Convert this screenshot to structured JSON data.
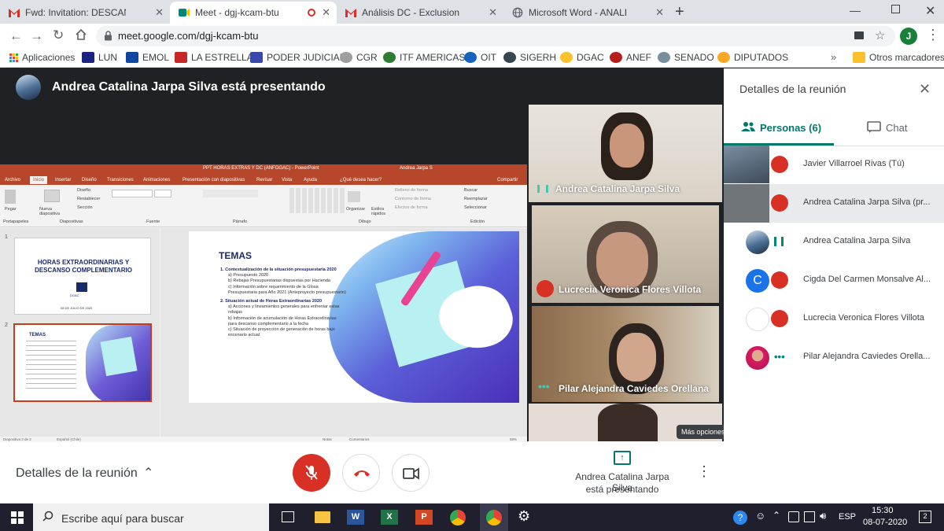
{
  "tabs": [
    {
      "title": "Fwd: Invitation: DESCANSO COM",
      "icon": "gmail-icon"
    },
    {
      "title": "Meet - dgj-kcam-btu",
      "icon": "meet-icon",
      "active": true
    },
    {
      "title": "Análisis DC - Exclusiones Enferme",
      "icon": "gmail-icon"
    },
    {
      "title": "Microsoft Word - ANALISIS POR",
      "icon": "globe-icon"
    }
  ],
  "address": {
    "url": "meet.google.com/dgj-kcam-btu",
    "profile_initial": "J"
  },
  "bookmarks": [
    {
      "label": "Aplicaciones",
      "color": "#5f6368"
    },
    {
      "label": "LUN",
      "color": "#1a237e"
    },
    {
      "label": "EMOL",
      "color": "#0d47a1"
    },
    {
      "label": "LA ESTRELLA",
      "color": "#c62828"
    },
    {
      "label": "PODER JUDICIAL",
      "color": "#3949ab"
    },
    {
      "label": "CGR",
      "color": "#9e9e9e"
    },
    {
      "label": "ITF AMERICAS",
      "color": "#2e7d32"
    },
    {
      "label": "OIT",
      "color": "#1565c0"
    },
    {
      "label": "SIGERH",
      "color": "#37474f"
    },
    {
      "label": "DGAC",
      "color": "#fbc02d"
    },
    {
      "label": "ANEF",
      "color": "#b71c1c"
    },
    {
      "label": "SENADO",
      "color": "#78909c"
    },
    {
      "label": "DIPUTADOS",
      "color": "#f9a825"
    }
  ],
  "bookmarks_other": "Otros marcadores",
  "meet": {
    "presenting_title": "Andrea Catalina Jarpa Silva está presentando",
    "panel_title": "Detalles de la reunión",
    "tab_people": "Personas (6)",
    "tab_chat": "Chat",
    "participants": [
      {
        "name": "Javier Villarroel Rivas (Tú)",
        "muted": true
      },
      {
        "name": "Andrea Catalina Jarpa Silva (pr...",
        "muted": true,
        "presenting": true
      },
      {
        "name": "Andrea Catalina Jarpa Silva",
        "muted": false
      },
      {
        "name": "Cigda Del Carmen Monsalve Al...",
        "muted": true,
        "initial": "C"
      },
      {
        "name": "Lucrecia Veronica Flores Villota",
        "muted": true
      },
      {
        "name": "Pilar Alejandra Caviedes Orella...",
        "muted": false
      }
    ],
    "tiles": [
      {
        "name": "Andrea Catalina Jarpa Silva"
      },
      {
        "name": "Lucrecia Veronica Flores Villota"
      },
      {
        "name": "Pilar Alejandra Caviedes Orellana"
      }
    ],
    "tooltip": "Más opciones",
    "bottom_details": "Detalles de la reunión",
    "bottom_presenting_line1": "Andrea Catalina Jarpa Silva",
    "bottom_presenting_line2": "está presentando"
  },
  "ppt": {
    "window_title": "PPT HORAS EXTRAS Y DC (ANFOGAC) - PowerPoint",
    "user": "Andrea Jarpa S",
    "ribbon_tabs": [
      "Archivo",
      "Inicio",
      "Insertar",
      "Diseño",
      "Transiciones",
      "Animaciones",
      "Presentación con diapositivas",
      "Revisar",
      "Vista",
      "Ayuda",
      "¿Qué desea hacer?"
    ],
    "share": "Compartir",
    "groups": [
      "Portapapeles",
      "Diapositivas",
      "Fuente",
      "Párrafo",
      "Dibujo",
      "Edición"
    ],
    "ribbon_buttons": {
      "paste": "Pegar",
      "new_slide": "Nueva diapositiva",
      "layout": "Diseño",
      "reset": "Restablecer",
      "section": "Sección",
      "arrange": "Organizar",
      "quick_styles": "Estilos rápidos",
      "fill": "Relleno de forma",
      "outline": "Contorno de forma",
      "effects": "Efectos de forma",
      "find": "Buscar",
      "replace": "Reemplazar",
      "select": "Seleccionar"
    },
    "slide1": {
      "num": "1",
      "title": "HORAS EXTRAORDINARIAS Y DESCANSO COMPLEMENTARIO",
      "org": "DGAC",
      "date": "08 DE JULIO DE 2020"
    },
    "slide2": {
      "num": "2",
      "title": "TEMAS"
    },
    "main": {
      "title": "TEMAS",
      "item1": "1. Contextualización de la situación presupuestaria 2020",
      "item1_subs": [
        "a)  Presupuesto 2020",
        "b)  Rebajas Presupuestarias dispuestas por Hacienda",
        "c)  Información sobre requerimiento de la Glosa Presupuestaria para Año 2021 (Anteproyecto presupuestario)"
      ],
      "item2": "2. Situación actual de Horas Extraordinarias 2020",
      "item2_subs": [
        "a)  Acciones y lineamientos generales para enfrentar estas rebajas",
        "b)  Información de acumulación de Horas Extraordinarias para descanso complementario a la fecha",
        "c)  Situación de proyección de generación de horas bajo escenario actual"
      ]
    },
    "status_left": "Diapositiva 2 de 2",
    "status_lang": "Español (Chile)",
    "status_notes": "Notas",
    "status_comments": "Comentarios",
    "zoom": "58%"
  },
  "taskbar": {
    "search_placeholder": "Escribe aquí para buscar",
    "lang": "ESP",
    "time": "15:30",
    "date": "08-07-2020",
    "notif_count": "2"
  }
}
